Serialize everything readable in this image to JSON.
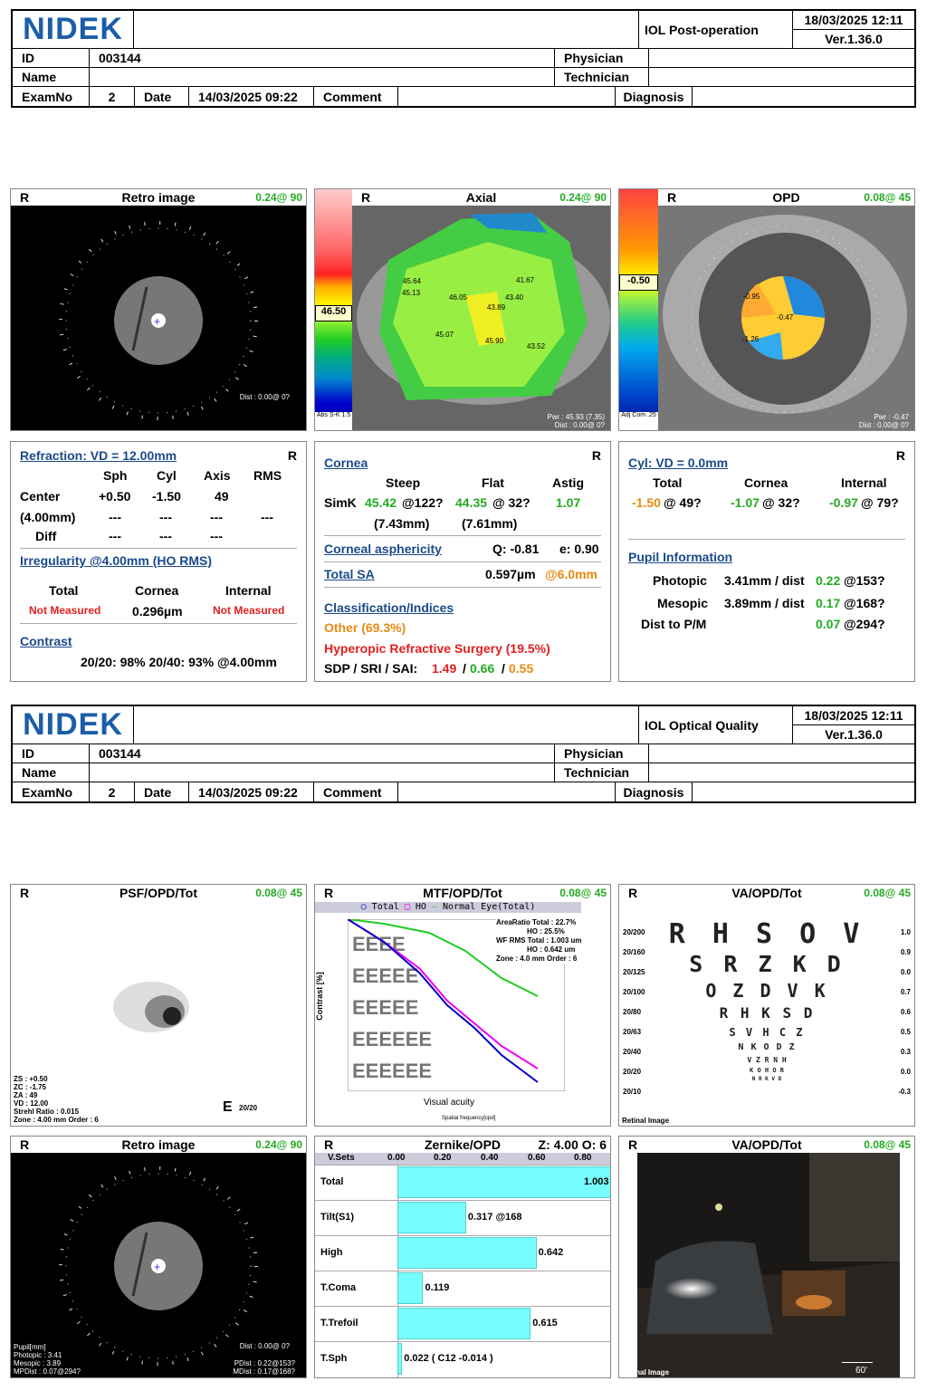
{
  "report1": {
    "brand": "NIDEK",
    "title": "IOL Post-operation",
    "datetime": "18/03/2025 12:11",
    "version": "Ver.1.36.0",
    "id_label": "ID",
    "id": "003144",
    "physician_label": "Physician",
    "name_label": "Name",
    "technician_label": "Technician",
    "examno_label": "ExamNo",
    "examno": "2",
    "date_label": "Date",
    "date": "14/03/2025 09:22",
    "comment_label": "Comment",
    "diagnosis_label": "Diagnosis"
  },
  "report2": {
    "brand": "NIDEK",
    "title": "IOL Optical Quality",
    "datetime": "18/03/2025 12:11",
    "version": "Ver.1.36.0",
    "id_label": "ID",
    "id": "003144",
    "physician_label": "Physician",
    "name_label": "Name",
    "technician_label": "Technician",
    "examno_label": "ExamNo",
    "examno": "2",
    "date_label": "Date",
    "date": "14/03/2025 09:22",
    "comment_label": "Comment",
    "diagnosis_label": "Diagnosis"
  },
  "panels": {
    "retro1": {
      "eye": "R",
      "title": "Retro image",
      "value": "0.24@ 90",
      "dist": "Dist : 0.00@ 0?"
    },
    "axial": {
      "eye": "R",
      "title": "Axial",
      "value": "0.24@ 90",
      "scale_value": "46.50",
      "pwr": "Pwr : 45.93 (7.35)",
      "dist": "Dist : 0.00@ 0?",
      "scale_foot": "Abs S-K 1.5",
      "labels": [
        "45.64",
        "41.67",
        "45.13",
        "46.05",
        "43.40",
        "43.89",
        "45.07",
        "45.90",
        "43.52"
      ]
    },
    "opd": {
      "eye": "R",
      "title": "OPD",
      "value": "0.08@ 45",
      "scale_value": "-0.50",
      "pwr": "Pwr : -0.47",
      "dist": "Dist : 0.00@ 0?",
      "scale_foot": "Adj Com .25",
      "labels": [
        "-0.95",
        "-0.47",
        "-1.26"
      ]
    },
    "refraction": {
      "eye": "R",
      "title": "Refraction: VD = 12.00mm",
      "cols": [
        "Sph",
        "Cyl",
        "Axis",
        "RMS"
      ],
      "center_label": "Center",
      "center": [
        "+0.50",
        "-1.50",
        "49"
      ],
      "zone_label": "(4.00mm)",
      "zone": [
        "---",
        "---",
        "---",
        "---"
      ],
      "diff_label": "Diff",
      "diff": [
        "---",
        "---",
        "---"
      ],
      "irreg_title": "Irregularity @4.00mm (HO RMS)",
      "irreg_cols": [
        "Total",
        "Cornea",
        "Internal"
      ],
      "irreg_vals": [
        "Not Measured",
        "0.296µm",
        "Not Measured"
      ],
      "contrast_title": "Contrast",
      "contrast": "20/20: 98%  20/40: 93%  @4.00mm"
    },
    "cornea": {
      "eye": "R",
      "title": "Cornea",
      "cols": [
        "Steep",
        "Flat",
        "Astig"
      ],
      "simk_label": "SimK",
      "steep": "45.42",
      "steep_axis": "@122?",
      "flat": "44.35",
      "flat_axis": "@ 32?",
      "astig": "1.07",
      "steep_mm": "(7.43mm)",
      "flat_mm": "(7.61mm)",
      "asph_title": "Corneal asphericity",
      "q": "Q: -0.81",
      "e": "e: 0.90",
      "sa_title": "Total SA",
      "sa": "0.597µm",
      "sa_zone": "@6.0mm",
      "class_title": "Classification/Indices",
      "class1": "Other (69.3%)",
      "class2": "Hyperopic Refractive Surgery (19.5%)",
      "sdp_label": "SDP / SRI / SAI:",
      "sdp": "1.49",
      "sri": "0.66",
      "sai": "0.55"
    },
    "cyl": {
      "eye": "R",
      "title": "Cyl: VD = 0.0mm",
      "cols": [
        "Total",
        "Cornea",
        "Internal"
      ],
      "total": "-1.50",
      "total_axis": "@ 49?",
      "cornea": "-1.07",
      "cornea_axis": "@ 32?",
      "internal": "-0.97",
      "internal_axis": "@ 79?",
      "pupil_title": "Pupil Information",
      "photopic_label": "Photopic",
      "photopic": "3.41mm / dist",
      "photopic_d": "0.22",
      "photopic_a": "@153?",
      "mesopic_label": "Mesopic",
      "mesopic": "3.89mm / dist",
      "mesopic_d": "0.17",
      "mesopic_a": "@168?",
      "pm_label": "Dist to P/M",
      "pm_d": "0.07",
      "pm_a": "@294?"
    },
    "psf": {
      "eye": "R",
      "title": "PSF/OPD/Tot",
      "value": "0.08@ 45",
      "info": [
        "ZS : +0.50",
        "ZC : -1.75",
        "ZA : 49",
        "VD : 12.00",
        "Strehl Ratio : 0.015",
        "Zone : 4.00 mm Order : 6"
      ],
      "va": "20/20"
    },
    "mtf": {
      "eye": "R",
      "title": "MTF/OPD/Tot",
      "value": "0.08@ 45",
      "legend": [
        "Total",
        "HO",
        "Normal Eye(Total)"
      ],
      "area_ratio": "AreaRatio Total : 22.7%",
      "area_ho": "HO : 25.5%",
      "wf_rms": "WF RMS",
      "wf_total": "Total : 1.003 um",
      "wf_ho": "HO : 0.642 um",
      "zone": "Zone : 4.0 mm Order : 6",
      "ylabel": "Contrast [%]",
      "xlabel": "Visual acuity",
      "xlabel2": "Spatial frequency[cpd]"
    },
    "va1": {
      "eye": "R",
      "title": "VA/OPD/Tot",
      "value": "0.08@ 45",
      "rows": [
        "R H S O V",
        "S R Z K D",
        "O Z D V K",
        "R H K S D",
        "S V H C Z",
        "N K O D Z",
        "V Z R N H",
        "K O H O R",
        "N R K V D"
      ],
      "left": [
        "20/200",
        "20/160",
        "20/125",
        "20/100",
        "20/80",
        "20/63",
        "20/40",
        "20/20",
        "20/10"
      ],
      "right": [
        "1.0",
        "0.9",
        "0.0",
        "0.7",
        "0.6",
        "0.5",
        "0.3",
        "0.0",
        "-0.3"
      ],
      "foot": "Retinal Image"
    },
    "retro2": {
      "eye": "R",
      "title": "Retro image",
      "value": "0.24@ 90",
      "info": [
        "Pupil[mm]",
        "Photopic : 3.41",
        "Mesopic : 3.89",
        "MPDist : 0.07@294?"
      ],
      "dist": "Dist : 0.00@ 0?",
      "pdist": "PDist : 0.22@153?",
      "mdist": "MDist : 0.17@168?"
    },
    "zernike": {
      "eye": "R",
      "title": "Zernike/OPD",
      "zo": "Z: 4.00 O: 6",
      "vsets": "V.Sets",
      "scale": [
        "0.00",
        "0.20",
        "0.40",
        "0.60",
        "0.80"
      ],
      "rows": [
        {
          "label": "Total",
          "value": "1.003",
          "frac": 1.0
        },
        {
          "label": "Tilt(S1)",
          "value": "0.317 @168",
          "frac": 0.317
        },
        {
          "label": "High",
          "value": "0.642",
          "frac": 0.642
        },
        {
          "label": "T.Coma",
          "value": "0.119",
          "frac": 0.119
        },
        {
          "label": "T.Trefoil",
          "value": "0.615",
          "frac": 0.615
        },
        {
          "label": "T.Sph",
          "value": "0.022 ( C12 -0.014 )",
          "frac": 0.022
        }
      ]
    },
    "va2": {
      "eye": "R",
      "title": "VA/OPD/Tot",
      "value": "0.08@ 45",
      "foot": "Retinal Image",
      "scale": "60'"
    }
  }
}
